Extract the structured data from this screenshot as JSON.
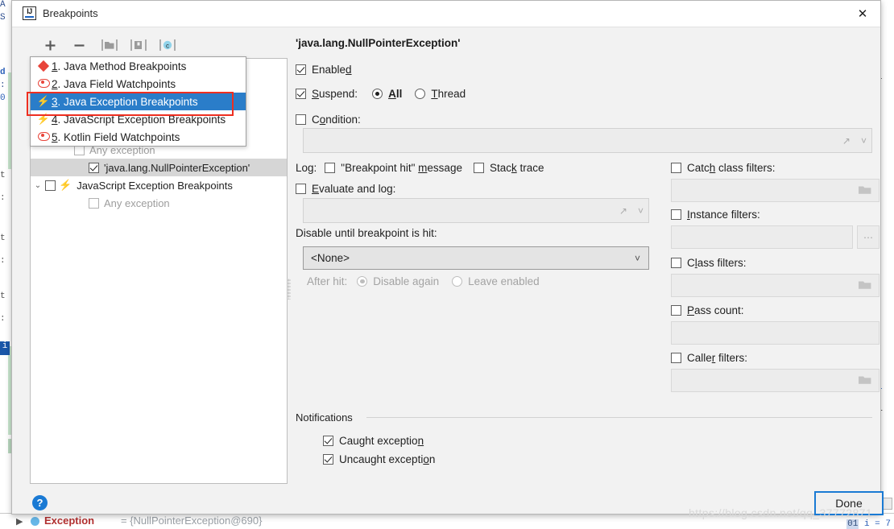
{
  "window": {
    "title": "Breakpoints",
    "app_icon": "intellij-idea-icon",
    "close_label": "✕"
  },
  "toolbar": {
    "add_label": "+",
    "remove_label": "−",
    "group_by_label": "folder-icon",
    "move_to_group_label": "folder-move-icon",
    "mute_label": "c"
  },
  "tree": {
    "rows": [
      {
        "indent": 36,
        "checkbox": "unchecked",
        "disabled": true,
        "label": "Any exception",
        "dim": true,
        "twisty": "",
        "icon": ""
      },
      {
        "indent": 54,
        "checkbox": "checked",
        "disabled": false,
        "label": "'java.lang.NullPointerException'",
        "dim": false,
        "twisty": "",
        "icon": "",
        "selected": true
      },
      {
        "indent": 12,
        "checkbox": "unchecked",
        "disabled": false,
        "label": "JavaScript Exception Breakpoints",
        "dim": false,
        "twisty": "⌄",
        "icon": "bolt"
      },
      {
        "indent": 54,
        "checkbox": "unchecked",
        "disabled": true,
        "label": "Any exception",
        "dim": true,
        "twisty": "",
        "icon": ""
      }
    ]
  },
  "menu": {
    "items": [
      {
        "icon": "diamond-icon",
        "num": "1",
        "label": ". Java Method Breakpoints",
        "active": false
      },
      {
        "icon": "eye-icon",
        "num": "2",
        "label": ". Java Field Watchpoints",
        "active": false
      },
      {
        "icon": "bolt-icon",
        "num": "3",
        "label": ". Java Exception Breakpoints",
        "active": true
      },
      {
        "icon": "bolt-icon",
        "num": "4",
        "label": ". JavaScript Exception Breakpoints",
        "active": false
      },
      {
        "icon": "eye-icon",
        "num": "5",
        "label": ". Kotlin Field Watchpoints",
        "active": false
      }
    ],
    "highlight_color": "#2a7dc9",
    "annotation_color": "#ee2f20"
  },
  "details": {
    "breakpoint_title": "'java.lang.NullPointerException'",
    "enabled": {
      "label": "Enable",
      "accel": "d",
      "checked": true
    },
    "suspend": {
      "label": "uspend:",
      "accel": "S",
      "checked": true,
      "options": [
        {
          "label": "All",
          "accel": "A",
          "rest": "ll",
          "selected": true
        },
        {
          "label": "Thread",
          "accel": "T",
          "rest": "hread",
          "selected": false
        }
      ]
    },
    "condition": {
      "label_pre": "C",
      "label_accel": "o",
      "label_post": "ndition:",
      "checked": false,
      "value": "",
      "expand_icon": "expand-icon",
      "history_icon": "chevron-down-icon"
    },
    "log": {
      "prefix": "Log:",
      "message": {
        "pre": "\"Breakpoint hit\" ",
        "accel": "m",
        "post": "essage",
        "checked": false
      },
      "stack_trace": {
        "pre": "Stac",
        "accel": "k",
        "post": " trace",
        "checked": false
      }
    },
    "evaluate_and_log": {
      "pre": "",
      "accel": "E",
      "post": "valuate and log:",
      "checked": false,
      "value": ""
    },
    "disable_until": {
      "label": "Disable until breakpoint is hit:",
      "selected": "<None>",
      "options": [
        "<None>"
      ]
    },
    "after_hit": {
      "label": "After hit:",
      "options": [
        {
          "label": "Disable again",
          "selected": true
        },
        {
          "label": "Leave enabled",
          "selected": false
        }
      ],
      "disabled": true
    },
    "filters": [
      {
        "pre": "Catc",
        "accel": "h",
        "post": " class filters:",
        "checked": false,
        "value": "",
        "button": "folder-icon"
      },
      {
        "pre": "",
        "accel": "I",
        "post": "nstance filters:",
        "checked": false,
        "value": "",
        "button": "ellipsis-icon"
      },
      {
        "pre": "C",
        "accel": "l",
        "post": "ass filters:",
        "checked": false,
        "value": "",
        "button": "folder-icon"
      },
      {
        "pre": "",
        "accel": "P",
        "post": "ass count:",
        "checked": false,
        "value": "",
        "button": "none"
      },
      {
        "pre": "Calle",
        "accel": "r",
        "post": " filters:",
        "checked": false,
        "value": "",
        "button": "folder-icon"
      }
    ],
    "notifications": {
      "title": "Notifications",
      "items": [
        {
          "pre": "Caught exceptio",
          "accel": "n",
          "post": "",
          "checked": true
        },
        {
          "pre": "Uncaught excepti",
          "accel": "o",
          "post": "n",
          "checked": true
        }
      ]
    }
  },
  "footer": {
    "help_label": "?",
    "done_label": "Done",
    "watermark": "https://blog.csdn.net/qq_37772871"
  },
  "background": {
    "exception_label": "Exception",
    "exception_value": "= {NullPointerException@690}",
    "code_line_number": "01",
    "code_snippet": "i = 7"
  }
}
